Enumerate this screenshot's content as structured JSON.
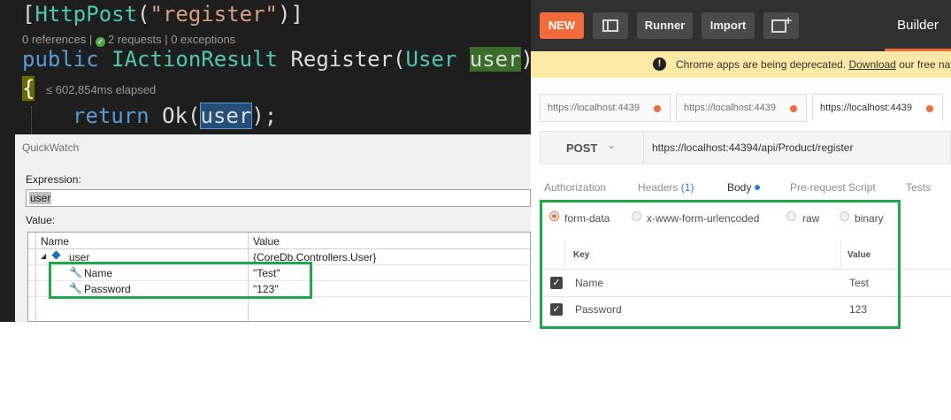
{
  "editor": {
    "line1": {
      "open": "[",
      "attr": "HttpPost",
      "p1": "(",
      "str": "\"register\"",
      "p2": ")]"
    },
    "codelens": {
      "references": "0 references",
      "sep1": " | ",
      "requests": "2 requests",
      "sep2": " | ",
      "exceptions": "0 exceptions"
    },
    "line2": {
      "kw": "public",
      "ret": "IActionResult",
      "method": "Register(",
      "ptype": "User",
      "pname": "user",
      "close": ")"
    },
    "line3": {
      "brace": "{",
      "perf": "≤ 602,854ms elapsed"
    },
    "line4": {
      "kw": "return",
      "call": "Ok(",
      "arg": "user",
      "end": ");"
    }
  },
  "quickwatch": {
    "title": "QuickWatch",
    "expression_label": "Expression:",
    "expression_value": "user",
    "value_label": "Value:",
    "columns": {
      "name": "Name",
      "value": "Value"
    },
    "rows": [
      {
        "name": "user",
        "value": "{CoreDb.Controllers.User}"
      },
      {
        "name": "Name",
        "value": "\"Test\""
      },
      {
        "name": "Password",
        "value": "\"123\""
      }
    ]
  },
  "postman": {
    "new_label": "NEW",
    "runner_label": "Runner",
    "import_label": "Import",
    "builder_label": "Builder",
    "banner_text": "Chrome apps are being deprecated.",
    "banner_link": "Download",
    "banner_rest": "our free nat",
    "tabs": [
      {
        "label": "https://localhost:4439"
      },
      {
        "label": "https://localhost:4439"
      },
      {
        "label": "https://localhost:4439"
      }
    ],
    "method": "POST",
    "url": "https://localhost:44394/api/Product/register",
    "request_tabs": {
      "authorization": "Authorization",
      "headers": "Headers",
      "headers_count": "(1)",
      "body": "Body",
      "prerequest": "Pre-request Script",
      "tests": "Tests"
    },
    "body_types": [
      "form-data",
      "x-www-form-urlencoded",
      "raw",
      "binary"
    ],
    "kv_headers": {
      "key": "Key",
      "value": "Value"
    },
    "kv_rows": [
      {
        "key": "Name",
        "value": "Test"
      },
      {
        "key": "Password",
        "value": "123"
      }
    ],
    "accent": "#f26b3a",
    "highlight": "#1ea84b"
  }
}
